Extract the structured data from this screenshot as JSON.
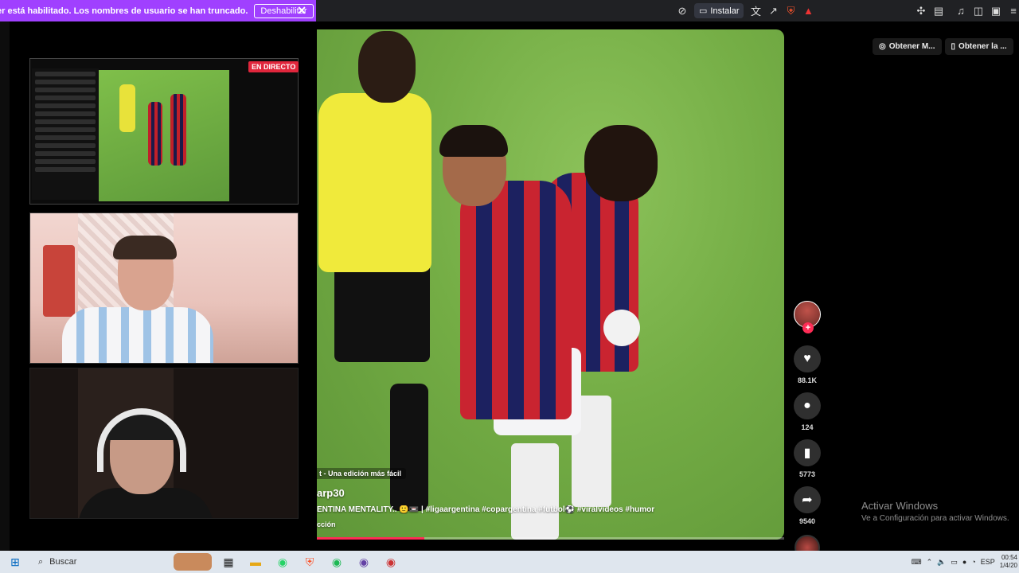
{
  "infobar": {
    "message": "er está habilitado. Los nombres de usuario se han truncado.",
    "disable_button": "Deshabilitar",
    "close_icon": "✕"
  },
  "browser_toolbar": {
    "install_label": "Instalar"
  },
  "top_right": {
    "btn1": "Obtener M...",
    "btn2": "Obtener la ..."
  },
  "stream": {
    "live_badge": "EN DIRECTO"
  },
  "video": {
    "edit_hint": "t - Una edición más fácil",
    "username": "arp30",
    "description": "ENTINA MENTALITY.. 🙂📼 | #ligaargentina #copargentina #futbol⚽ #viralvideos #humor",
    "music": "cción",
    "progress": 0.23
  },
  "actions": {
    "likes": "88.1K",
    "comments": "124",
    "saves": "5773",
    "shares": "9540"
  },
  "watermark": {
    "title": "Activar Windows",
    "subtitle": "Ve a Configuración para activar Windows."
  },
  "taskbar": {
    "search_label": "Buscar",
    "lang": "ESP",
    "time": "00:54",
    "date": "1/4/20"
  },
  "colors": {
    "infobar": "#a040ff",
    "accent": "#fe2c55"
  }
}
